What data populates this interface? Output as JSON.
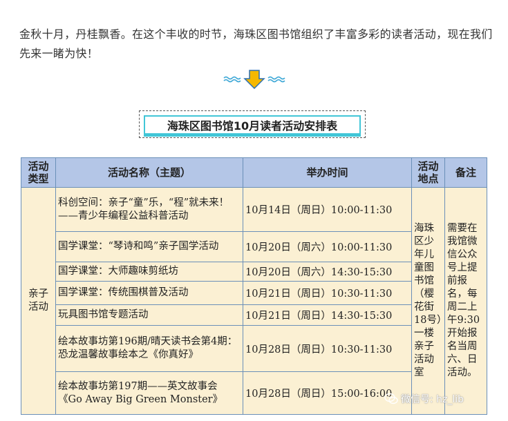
{
  "intro_text": "金秋十月，丹桂飘香。在这个丰收的时节，海珠区图书馆组织了丰富多彩的读者活动，现在我们先来一睹为快！",
  "table_title": "海珠区图书馆10月读者活动安排表",
  "columns": {
    "type": "活动类型",
    "name": "活动名称（主题）",
    "time": "举办时间",
    "place": "活动地点",
    "note": "备注"
  },
  "activity_type": "亲子活动",
  "place": "海珠区少年儿童图书馆（樱花街18号）一楼亲子活动室",
  "note": "需要在我馆微信公众号上提前报名，每周二上午9:30开始报名当周六、日活动。",
  "rows": [
    {
      "name": "科创空间：亲子“童”乐，“程”就未来！——青少年编程公益科普活动",
      "time": "10月14日（周日）10:00-11:30"
    },
    {
      "name": "国学课堂：“琴诗和鸣”亲子国学活动",
      "time": "10月20日（周六）10:00-11:30"
    },
    {
      "name": "国学课堂：大师趣味剪纸坊",
      "time": "10月20日（周六）14:30-15:30"
    },
    {
      "name": "国学课堂：传统围棋普及活动",
      "time": "10月21日（周日）10:30-11:30"
    },
    {
      "name": "玩具图书馆专题活动",
      "time": "10月21日（周日）14:30-15:30"
    },
    {
      "name": "绘本故事坊第196期/晴天读书会第4期：恐龙温馨故事绘本之《你真好》",
      "time": "10月28日（周日）10:30-11:30"
    },
    {
      "name": "绘本故事坊第197期——英文故事会《Go Away Big Green Monster》",
      "time": "10月28日（周日）15:00-16:00"
    }
  ],
  "watermark": "微信号: hz_lib",
  "colors": {
    "header_bg": "#b4c6e7",
    "body_bg": "#fbf0d3",
    "border": "#6a8fb8",
    "title_accent": "#41c6d7",
    "arrow": "#f5b800"
  },
  "icons": {
    "divider": "down-arrow-icon",
    "watermark": "wechat-icon"
  }
}
